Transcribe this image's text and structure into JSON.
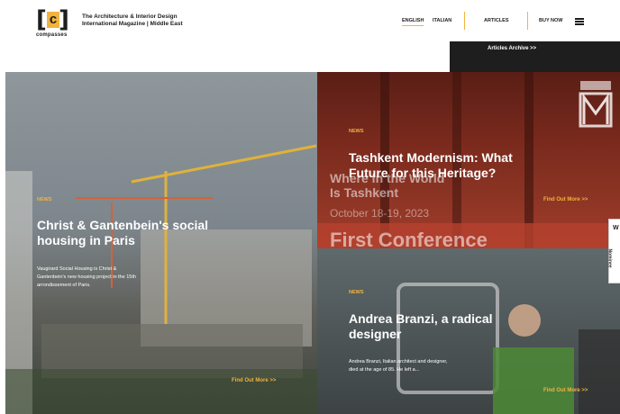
{
  "header": {
    "logo_text": "c",
    "logo_sub": "compasses",
    "tagline_line1": "The Architecture & Interior Design",
    "tagline_line2": "International Magazine | Middle East",
    "nav": {
      "english": "ENGLISH",
      "italian": "ITALIAN",
      "articles": "ARTICLES",
      "buy_now": "BUY NOW"
    },
    "archive_label": "Articles Archive >>"
  },
  "articles": [
    {
      "category": "NEWS",
      "title_line1": "Christ & Gantenbein's social",
      "title_line2": "housing in Paris",
      "excerpt_line1": "Vaugirard Social Housing is Christ &",
      "excerpt_line2": "Gantenbein's new housing project in the 15th",
      "excerpt_line3": "arrondissement of Paris.",
      "cta": "Find Out More >>"
    },
    {
      "category": "NEWS",
      "title_line1": "Tashkent Modernism: What",
      "title_line2": "Future for this Heritage?",
      "cta": "Find Out More >>",
      "bg_line1": "Where in the World",
      "bg_line2": "Is Tashkent",
      "bg_date": "October 18-19, 2023",
      "bg_conf": "First Conference"
    },
    {
      "category": "NEWS",
      "title_line1": "Andrea Branzi, a radical",
      "title_line2": "designer",
      "excerpt_line1": "Andrea Branzi, Italian architect and designer,",
      "excerpt_line2": "died at the age of 85. He left a...",
      "cta": "Find Out More >>"
    }
  ],
  "side_tab": {
    "letter": "W",
    "vertical": "Nominee"
  },
  "colors": {
    "accent": "#f2b33d",
    "dark": "#1e1e1e"
  }
}
